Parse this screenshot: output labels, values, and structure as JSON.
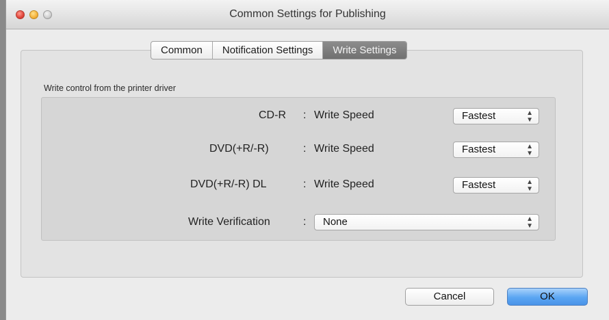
{
  "window": {
    "title": "Common Settings for Publishing"
  },
  "tabs": [
    {
      "label": "Common",
      "active": false
    },
    {
      "label": "Notification Settings",
      "active": false
    },
    {
      "label": "Write Settings",
      "active": true
    }
  ],
  "write_control": {
    "group_label": "Write control from the printer driver",
    "rows": [
      {
        "media": "CD-R",
        "sep": ":",
        "setting": "Write Speed",
        "value": "Fastest"
      },
      {
        "media": "DVD(+R/-R)",
        "sep": ":",
        "setting": "Write Speed",
        "value": "Fastest"
      },
      {
        "media": "DVD(+R/-R) DL",
        "sep": ":",
        "setting": "Write Speed",
        "value": "Fastest"
      }
    ],
    "verification": {
      "label": "Write Verification",
      "sep": ":",
      "value": "None"
    }
  },
  "buttons": {
    "cancel": "Cancel",
    "ok": "OK"
  },
  "colors": {
    "accent": "#5aa5f2",
    "active_tab": "#7d7d7d"
  }
}
